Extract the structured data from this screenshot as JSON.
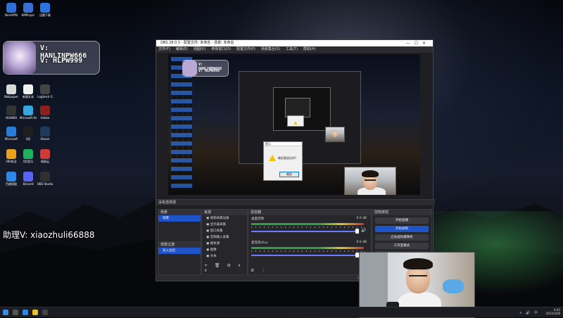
{
  "desktop": {
    "icons": [
      {
        "label": "NordVPN",
        "color": "#2f6fd9"
      },
      {
        "label": "KMPlayer",
        "color": "#3b6fd6"
      },
      {
        "label": "迅雷下载",
        "color": "#2b74e0"
      },
      {
        "label": "Wallpaper",
        "color": "#d9d9d9"
      },
      {
        "label": "新建文本",
        "color": "#f0f0f0"
      },
      {
        "label": "Logitech G",
        "color": "#444"
      },
      {
        "label": "HUAWEI",
        "color": "#333"
      },
      {
        "label": "Microsoft Edge",
        "color": "#36a6e0"
      },
      {
        "label": "Adobe",
        "color": "#8f1f1f"
      },
      {
        "label": "Microsoft",
        "color": "#2a7ad8"
      },
      {
        "label": "QQ",
        "color": "#1f1f1f"
      },
      {
        "label": "Steam",
        "color": "#1d3a5a"
      },
      {
        "label": "360安全",
        "color": "#e8a21c"
      },
      {
        "label": "QQ音乐",
        "color": "#1fb15b"
      },
      {
        "label": "网易云",
        "color": "#d23a3a"
      },
      {
        "label": "百度网盘",
        "color": "#2f88e8"
      },
      {
        "label": "Discord",
        "color": "#5865f2"
      },
      {
        "label": "OBS Studio",
        "color": "#303030"
      }
    ],
    "assistant_text": "助理V: xiaozhuli66888"
  },
  "watermark": {
    "line1": "V: HANLINPW666",
    "line2": "V: HLPW999"
  },
  "obs": {
    "title": "OBS 28.0.3 - 配置文件: 未命名 - 场景: 未命名",
    "menu": [
      "文件(F)",
      "编辑(E)",
      "视图(V)",
      "停靠窗口(D)",
      "配置文件(P)",
      "场景集合(S)",
      "工具(T)",
      "帮助(H)"
    ],
    "dialog": {
      "title": "提示",
      "message": "确定要退出吗?",
      "button": "确定"
    },
    "source_tab": "没有选择源",
    "scenes": {
      "header": "场景",
      "items": [
        "场景"
      ]
    },
    "sources": {
      "header": "来源",
      "items": [
        "视频采集设备",
        "显示器采集",
        "窗口采集",
        "音频输入采集",
        "媒体源",
        "图像",
        "文本"
      ]
    },
    "mixer": {
      "header": "混音器",
      "channels": [
        {
          "name": "桌面音频",
          "db": "0.0 dB"
        },
        {
          "name": "麦克风/Aux",
          "db": "0.0 dB"
        }
      ]
    },
    "transitions": {
      "header": "场景过渡",
      "items": [
        "淡入淡出"
      ]
    },
    "controls": {
      "header": "控制按钮",
      "buttons": [
        "开始直播",
        "开始录制",
        "启动虚拟摄像机",
        "工作室模式",
        "设置",
        "退出"
      ]
    },
    "status": "LIVE: 00:00:00  REC: 00:00:00  CPU: 3.5%, 30.00 fps"
  },
  "taskbar": {
    "time": "6:45",
    "date": "2023/10/8"
  }
}
